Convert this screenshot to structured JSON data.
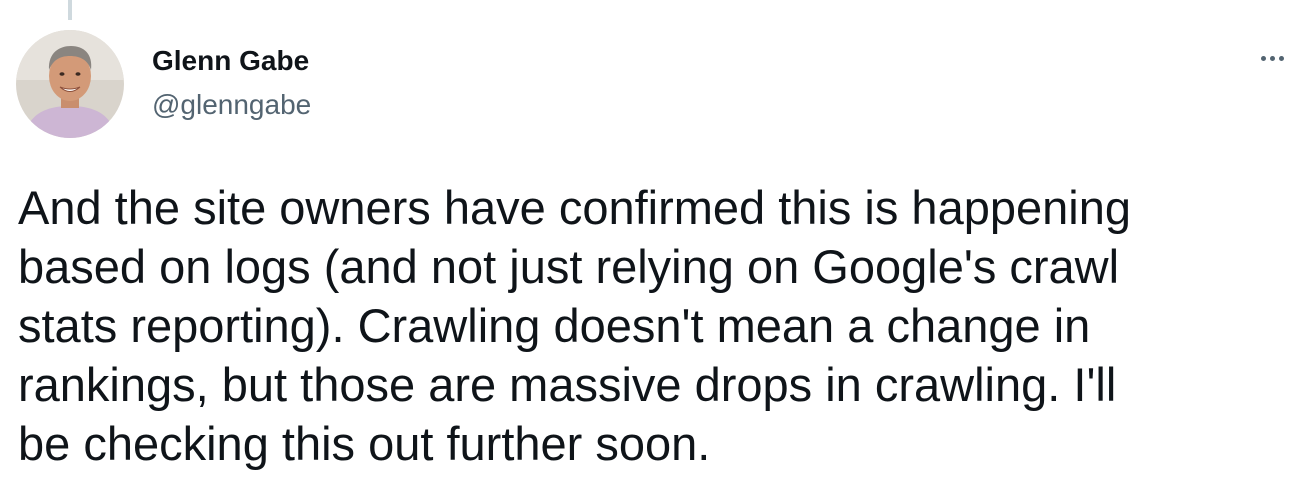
{
  "author": {
    "name": "Glenn Gabe",
    "handle": "@glenngabe",
    "avatar_icon": "user-avatar-photo"
  },
  "more_icon": "more-horizontal-icon",
  "tweet": {
    "lines": [
      "And the site owners have confirmed this is happening",
      "based on logs (and not just relying on Google's crawl",
      "stats reporting). Crawling doesn't mean a change in",
      "rankings, but those are massive drops in crawling. I'll",
      "be checking this out further soon."
    ]
  },
  "colors": {
    "text_primary": "#0f1419",
    "text_secondary": "#536471",
    "thread_line": "#cfd9de"
  }
}
